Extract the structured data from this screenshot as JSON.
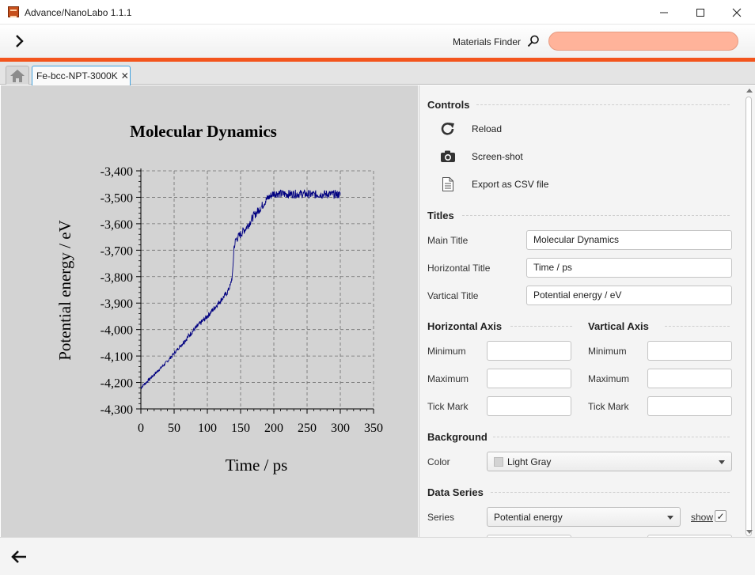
{
  "window": {
    "title": "Advance/NanoLabo 1.1.1",
    "minimize_icon": "minimize-icon",
    "maximize_icon": "maximize-icon",
    "close_icon": "close-icon"
  },
  "toolbar": {
    "expand_icon": "chevron-right-icon",
    "materials_finder_label": "Materials Finder",
    "search_icon": "search-icon",
    "search_value": "",
    "accent_color": "#f3541c",
    "search_bg_color": "#ffb39a"
  },
  "tabs": {
    "home_icon": "home-icon",
    "active_tab_label": "Fe-bcc-NPT-3000K",
    "close_glyph": "✕"
  },
  "chart_data": {
    "type": "line",
    "title": "Molecular Dynamics",
    "xlabel": "Time / ps",
    "ylabel": "Potential energy / eV",
    "xlim": [
      0,
      350
    ],
    "ylim": [
      -4300,
      -3400
    ],
    "xticks": [
      "0",
      "50",
      "100",
      "150",
      "200",
      "250",
      "300",
      "350"
    ],
    "yticks": [
      "-3,400",
      "-3,500",
      "-3,600",
      "-3,700",
      "-3,800",
      "-3,900",
      "-4,000",
      "-4,100",
      "-4,200",
      "-4,300"
    ],
    "grid": true,
    "background": "#d3d3d3",
    "series": [
      {
        "name": "Potential energy",
        "color": "#000080",
        "x": [
          0,
          20,
          40,
          60,
          80,
          100,
          120,
          130,
          135,
          138,
          140,
          143,
          150,
          160,
          170,
          180,
          190,
          200,
          220,
          240,
          260,
          280,
          300
        ],
        "y": [
          -4220,
          -4170,
          -4120,
          -4060,
          -4000,
          -3950,
          -3890,
          -3860,
          -3830,
          -3790,
          -3690,
          -3660,
          -3640,
          -3610,
          -3570,
          -3540,
          -3505,
          -3485,
          -3488,
          -3487,
          -3490,
          -3488,
          -3490
        ]
      }
    ]
  },
  "controls": {
    "heading": "Controls",
    "items": [
      {
        "icon": "reload-icon",
        "label": "Reload"
      },
      {
        "icon": "camera-icon",
        "label": "Screen-shot"
      },
      {
        "icon": "document-icon",
        "label": "Export as CSV file"
      }
    ]
  },
  "titles": {
    "heading": "Titles",
    "main_label": "Main Title",
    "main_value": "Molecular Dynamics",
    "horizontal_label": "Horizontal Title",
    "horizontal_value": "Time / ps",
    "vertical_label": "Vartical Title",
    "vertical_value": "Potential energy / eV"
  },
  "horizontal_axis": {
    "heading": "Horizontal Axis",
    "minimum_label": "Minimum",
    "maximum_label": "Maximum",
    "tick_label": "Tick Mark",
    "minimum_value": "",
    "maximum_value": "",
    "tick_value": ""
  },
  "vertical_axis": {
    "heading": "Vartical Axis",
    "minimum_label": "Minimum",
    "maximum_label": "Maximum",
    "tick_label": "Tick Mark",
    "minimum_value": "",
    "maximum_value": "",
    "tick_value": ""
  },
  "background": {
    "heading": "Background",
    "color_label": "Color",
    "color_value": "Light Gray",
    "swatch_color": "#d3d3d3"
  },
  "data_series": {
    "heading": "Data Series",
    "series_label": "Series",
    "series_value": "Potential energy",
    "show_label": "show",
    "show_checked": true,
    "check_glyph": "✓"
  },
  "bottom": {
    "back_icon": "arrow-left-icon"
  }
}
